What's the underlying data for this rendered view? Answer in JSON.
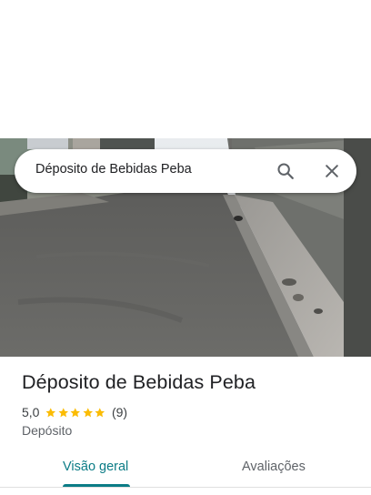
{
  "search": {
    "query": "Déposito de Bebidas Peba"
  },
  "icons": {
    "search": "search-icon",
    "close": "close-icon",
    "star": "star-icon"
  },
  "place": {
    "name": "Déposito de Bebidas Peba",
    "rating_text": "5,0",
    "rating": 5,
    "review_count": "(9)",
    "category": "Depósito"
  },
  "tabs": [
    {
      "label": "Visão geral",
      "selected": true
    },
    {
      "label": "Avaliações",
      "selected": false
    }
  ],
  "colors": {
    "accent": "#0b7c86",
    "star": "#fbbc04",
    "text": "#202124",
    "secondary": "#5f6368"
  }
}
